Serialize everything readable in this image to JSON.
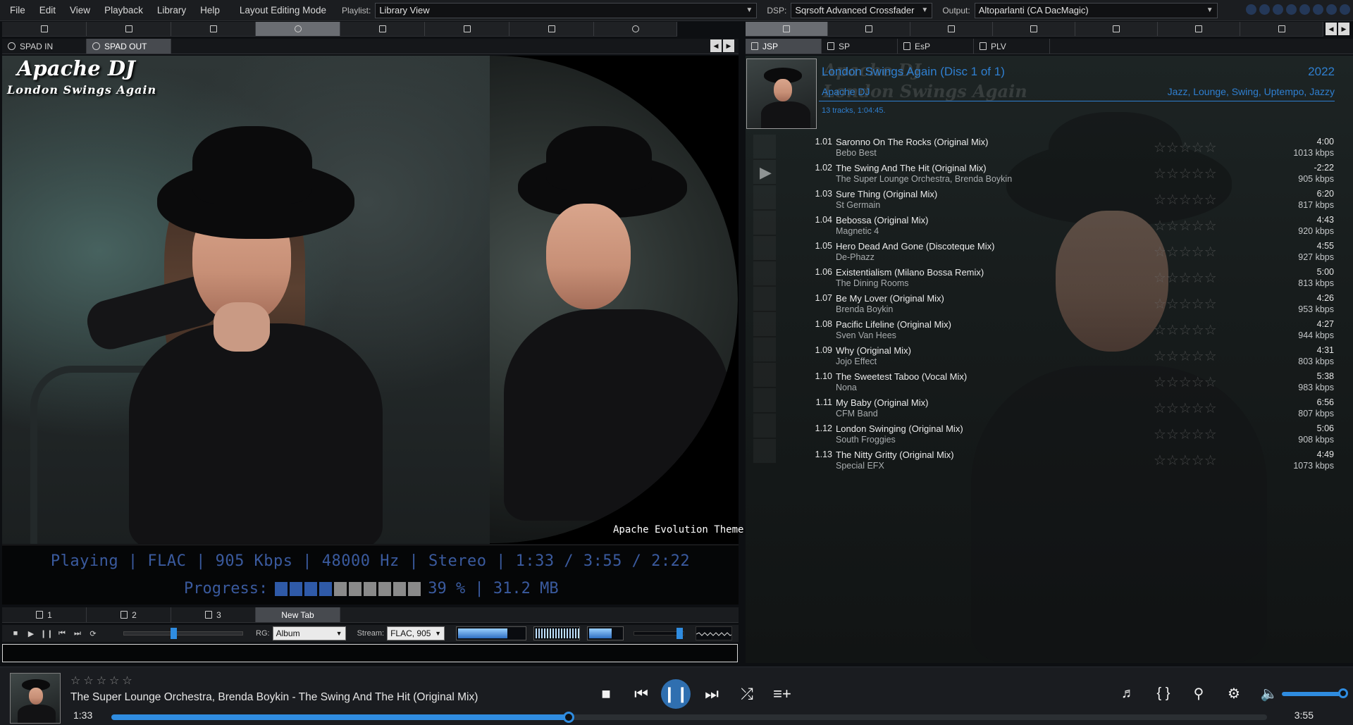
{
  "menu": {
    "items": [
      "File",
      "Edit",
      "View",
      "Playback",
      "Library",
      "Help"
    ],
    "layout_mode": "Layout Editing Mode",
    "playlist_label": "Playlist:",
    "playlist_value": "Library View",
    "dsp_label": "DSP:",
    "dsp_value": "Sqrsoft Advanced Crossfader",
    "output_label": "Output:",
    "output_value": "Altoparlanti (CA DacMagic)"
  },
  "left_tabs": [
    "SPAD IN",
    "SPAD OUT"
  ],
  "right_tabs": [
    "JSP",
    "SP",
    "EsP",
    "PLV"
  ],
  "overlay": {
    "artist": "Apache DJ",
    "album": "London Swings Again",
    "theme": "Apache Evolution Theme"
  },
  "status": {
    "line": "Playing | FLAC | 905 Kbps | 48000 Hz | Stereo | 1:33 / 3:55 / 2:22",
    "progress_label": "Progress:",
    "progress_cells_on": 4,
    "progress_cells_total": 10,
    "progress_text": "39 % | 31.2 MB"
  },
  "lower_tabs": [
    "1",
    "2",
    "3",
    "New Tab"
  ],
  "lower_controls": {
    "rg_label": "RG:",
    "rg_value": "Album",
    "stream_label": "Stream:",
    "stream_value": "FLAC, 905"
  },
  "album_header": {
    "title": "London Swings Again (Disc 1 of 1)",
    "year": "2022",
    "artist": "Apache DJ",
    "genres": "Jazz, Lounge, Swing, Uptempo, Jazzy",
    "count": "13 tracks, 1:04:45."
  },
  "tracks": [
    {
      "num": "1.01",
      "title": "Saronno On The Rocks (Original Mix)",
      "artist": "Bebo Best",
      "dur": "4:00",
      "kbps": "1013 kbps"
    },
    {
      "num": "1.02",
      "title": "The Swing And The Hit (Original Mix)",
      "artist": "The Super Lounge Orchestra, Brenda Boykin",
      "dur": "-2:22",
      "kbps": "905 kbps"
    },
    {
      "num": "1.03",
      "title": "Sure Thing (Original Mix)",
      "artist": "St Germain",
      "dur": "6:20",
      "kbps": "817 kbps"
    },
    {
      "num": "1.04",
      "title": "Bebossa (Original Mix)",
      "artist": "Magnetic 4",
      "dur": "4:43",
      "kbps": "920 kbps"
    },
    {
      "num": "1.05",
      "title": "Hero Dead And Gone (Discoteque Mix)",
      "artist": "De-Phazz",
      "dur": "4:55",
      "kbps": "927 kbps"
    },
    {
      "num": "1.06",
      "title": "Existentialism (Milano Bossa Remix)",
      "artist": "The Dining Rooms",
      "dur": "5:00",
      "kbps": "813 kbps"
    },
    {
      "num": "1.07",
      "title": "Be My Lover (Original Mix)",
      "artist": "Brenda Boykin",
      "dur": "4:26",
      "kbps": "953 kbps"
    },
    {
      "num": "1.08",
      "title": "Pacific Lifeline (Original Mix)",
      "artist": "Sven Van Hees",
      "dur": "4:27",
      "kbps": "944 kbps"
    },
    {
      "num": "1.09",
      "title": "Why (Original Mix)",
      "artist": "Jojo Effect",
      "dur": "4:31",
      "kbps": "803 kbps"
    },
    {
      "num": "1.10",
      "title": "The Sweetest Taboo (Vocal Mix)",
      "artist": "Nona",
      "dur": "5:38",
      "kbps": "983 kbps"
    },
    {
      "num": "1.11",
      "title": "My Baby (Original Mix)",
      "artist": "CFM Band",
      "dur": "6:56",
      "kbps": "807 kbps"
    },
    {
      "num": "1.12",
      "title": "London Swinging (Original Mix)",
      "artist": "South Froggies",
      "dur": "5:06",
      "kbps": "908 kbps"
    },
    {
      "num": "1.13",
      "title": "The Nitty Gritty (Original Mix)",
      "artist": "Special EFX",
      "dur": "4:49",
      "kbps": "1073 kbps"
    }
  ],
  "player": {
    "now_playing": "The Super Lounge Orchestra, Brenda Boykin - The Swing And The Hit (Original Mix)",
    "elapsed": "1:33",
    "total": "3:55",
    "progress_fraction": 0.396,
    "volume_fraction": 1.0
  },
  "colors": {
    "accent": "#2f8ce0",
    "header_text": "#2f7fd0",
    "status_text": "#3a5a9e"
  },
  "icons": {
    "player_controls": [
      "stop-icon",
      "previous-icon",
      "pause-icon",
      "next-icon",
      "shuffle-icon",
      "add-to-queue-icon"
    ],
    "player_right": [
      "playlist-icon",
      "braces-icon",
      "search-icon",
      "gear-icon",
      "volume-icon"
    ]
  }
}
